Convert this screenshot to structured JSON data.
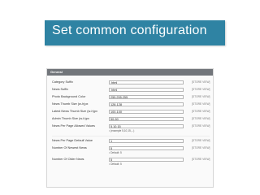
{
  "slide": {
    "title": "Set common configuration"
  },
  "panel": {
    "header": "General",
    "fields": [
      {
        "label": "Category Suffix",
        "value": ".html",
        "scope": "[STORE VIEW]"
      },
      {
        "label": "News Suffix",
        "value": ".html",
        "scope": "[STORE VIEW]"
      },
      {
        "label": "Photo Background Color",
        "value": "255,255,255",
        "scope": "[STORE VIEW]"
      },
      {
        "label": "News Thumb Size (w-h)px",
        "value": "128-128",
        "scope": "[STORE VIEW]"
      },
      {
        "label": "Latest News Thumb Size (w-h)px",
        "value": "100-100",
        "scope": "[STORE VIEW]"
      },
      {
        "label": "Admin Thumb Size (w-h)px",
        "value": "50-50",
        "scope": "[STORE VIEW]"
      },
      {
        "label": "News Per Page Allowed Values",
        "value": "5,10,15",
        "scope": "[STORE VIEW]",
        "note": "(example 5,10,15,...)"
      },
      {
        "label": "News Per Page Default Value",
        "value": "1",
        "scope": "[STORE VIEW]"
      },
      {
        "label": "Number Of Newest News",
        "value": "5",
        "scope": "[STORE VIEW]",
        "note": "Default: 5"
      },
      {
        "label": "Number Of Older News",
        "value": "5",
        "scope": "[STORE VIEW]",
        "note": "Default: 5"
      }
    ]
  },
  "icons": {
    "note_bullet": "bullet-icon"
  },
  "colors": {
    "title_banner": "#2f83a3",
    "panel_header": "#72767b",
    "title_text": "#ffffff"
  }
}
